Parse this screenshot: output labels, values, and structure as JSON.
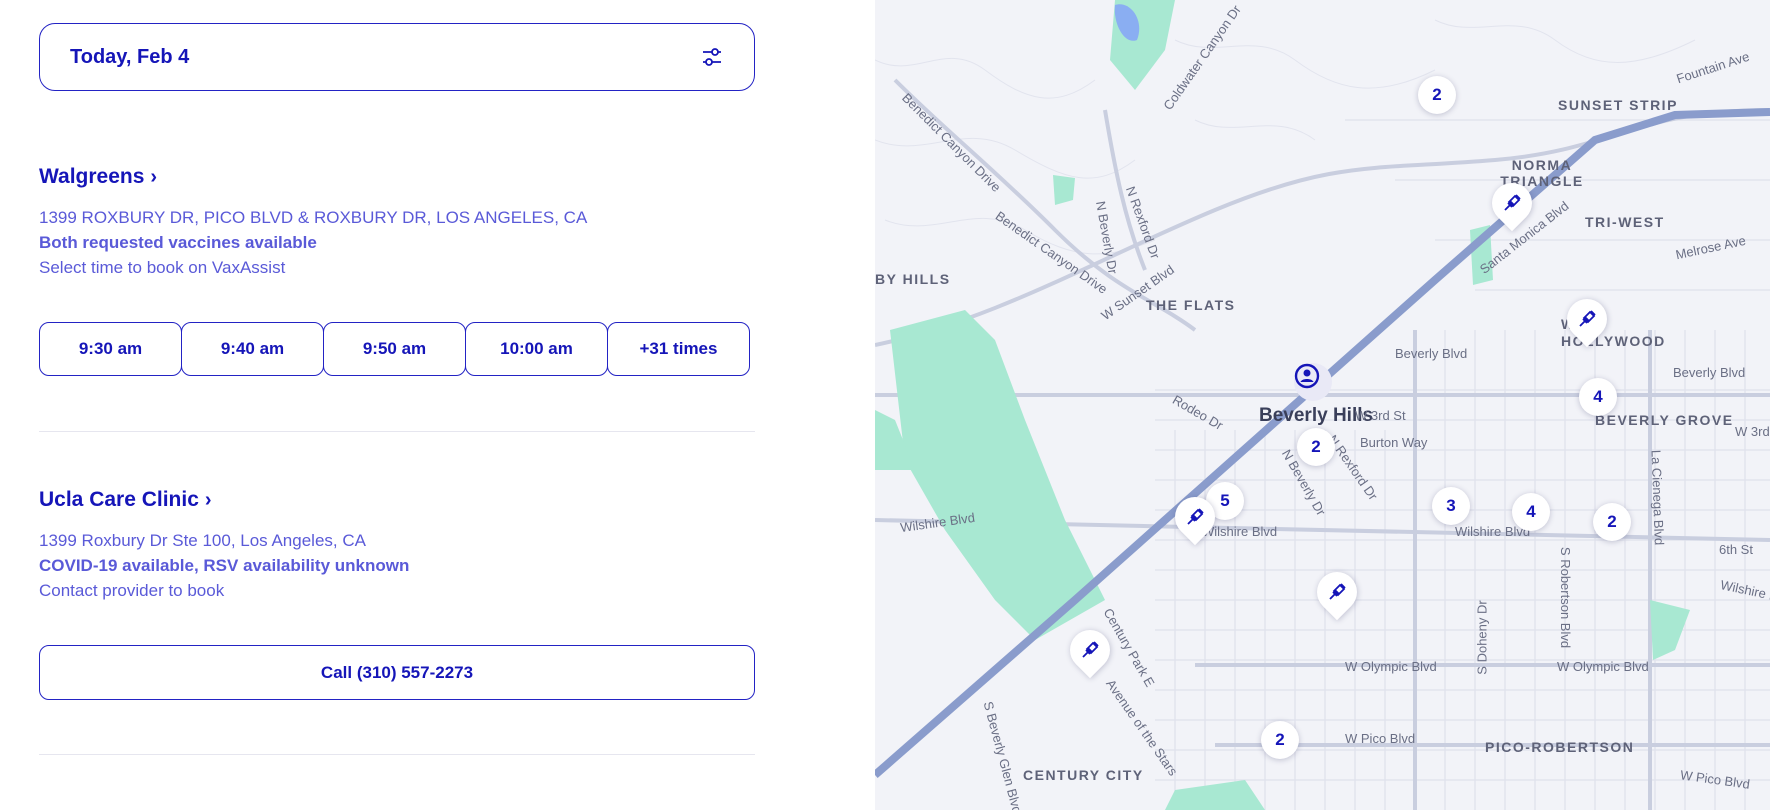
{
  "date_filter": {
    "label": "Today, Feb 4",
    "icon": "sliders-icon"
  },
  "providers": [
    {
      "name": "Walgreens",
      "address": "1399 ROXBURY DR, PICO BLVD & ROXBURY DR, LOS ANGELES, CA",
      "availability": "Both requested vaccines available",
      "note": "Select time to book on VaxAssist",
      "times": [
        "9:30 am",
        "9:40 am",
        "9:50 am",
        "10:00 am",
        "+31 times"
      ]
    },
    {
      "name": "Ucla Care Clinic",
      "address": "1399 Roxbury Dr Ste 100, Los Angeles, CA",
      "availability": "COVID-19 available, RSV availability unknown",
      "note": "Contact provider to book",
      "call_label": "Call (310) 557-2273"
    }
  ],
  "map": {
    "clusters": [
      "2",
      "4",
      "2",
      "5",
      "3",
      "4",
      "2",
      "2"
    ],
    "labels": {
      "city": "Beverly Hills",
      "sunset_strip": "SUNSET STRIP",
      "norma_triangle": "NORMA TRIANGLE",
      "tri_west": "TRI-WEST",
      "flats": "THE FLATS",
      "hills": "BY HILLS",
      "west_hollywood": "WEST HOLLYWOOD",
      "beverly_grove": "BEVERLY GROVE",
      "century_city": "CENTURY CITY",
      "pico_robertson": "PICO-ROBERTSON",
      "fountain_ave": "Fountain Ave",
      "melrose_ave": "Melrose Ave",
      "beverly_blvd_1": "Beverly Blvd",
      "beverly_blvd_2": "Beverly Blvd",
      "w3rd_1": "W 3rd St",
      "w3rd_2": "W 3rd",
      "burton_way": "Burton Way",
      "wilshire_1": "Wilshire Blvd",
      "wilshire_2": "Wilshire Blvd",
      "wilshire_3": "Wilshire Blvd",
      "wilshire_4": "Wilshire B",
      "olympic_1": "W Olympic Blvd",
      "olympic_2": "W Olympic Blvd",
      "pico_1": "W Pico Blvd",
      "pico_2": "W Pico Blvd",
      "sixth": "6th St",
      "santa_monica": "Santa Monica Blvd",
      "rodeo": "Rodeo Dr",
      "n_beverly_dr": "N Beverly Dr",
      "n_rexford": "N Rexford Dr",
      "benedict_1": "Benedict Canyon Drive",
      "benedict_2": "Benedict Canyon Drive",
      "coldwater": "Coldwater Canyon Dr",
      "w_sunset": "W Sunset Blvd",
      "la_cienega": "La Cienega Blvd",
      "s_robertson": "S Robertson Blvd",
      "s_doheny": "S Doheny Dr",
      "century_park": "Century Park E",
      "avenue_stars": "Avenue of the Stars",
      "s_beverly_glen": "S Beverly Glen Blvd"
    }
  },
  "colors": {
    "accent": "#1515b8",
    "secondary_text": "#5a5ad8",
    "map_bg": "#f2f3f8",
    "park": "#a8e8d2",
    "freeway": "#8a9ccc"
  }
}
